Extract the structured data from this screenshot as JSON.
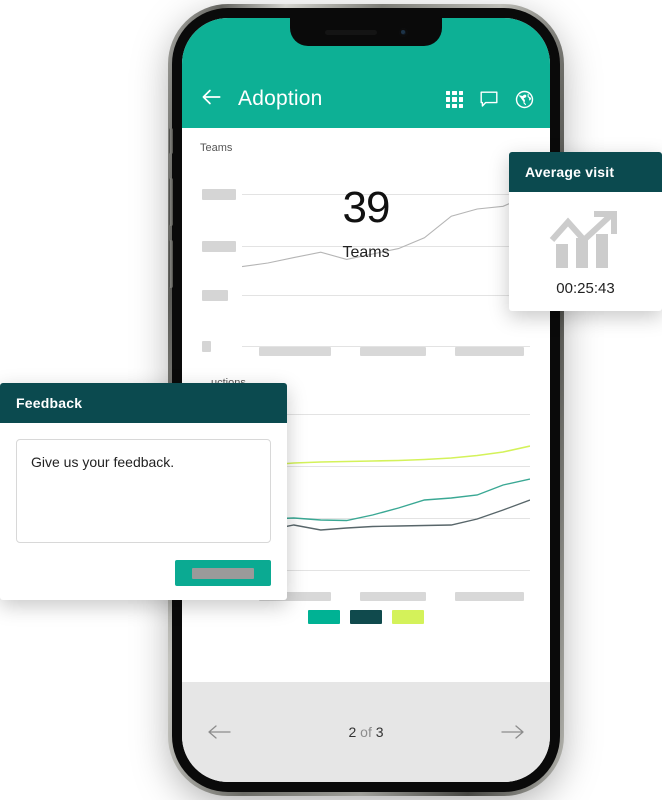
{
  "app": {
    "header": {
      "back_icon": "back-arrow-icon",
      "title": "Adoption",
      "icons": [
        {
          "name": "grid-icon",
          "label": "grid"
        },
        {
          "name": "comment-icon",
          "label": "comment"
        },
        {
          "name": "globe-icon",
          "label": "globe"
        }
      ]
    },
    "pager": {
      "prev_icon": "arrow-left-icon",
      "next_icon": "arrow-right-icon",
      "current": "2",
      "separator": " of ",
      "total": "3",
      "text": "2 of 3"
    }
  },
  "cards": {
    "average_visit": {
      "title": "Average visit",
      "icon": "bar-chart-trend-up-icon",
      "value": "00:25:43"
    },
    "feedback": {
      "title": "Feedback",
      "input_value": "Give us your feedback.",
      "input_placeholder": "Give us your feedback.",
      "submit_label": ""
    }
  },
  "colors": {
    "header_green": "#0DB095",
    "card_header_dark": "#0B4A4F",
    "accent_teal": "#00B294",
    "accent_dark_teal": "#104A4D",
    "accent_lime": "#D4F25A",
    "pager_bg": "#E6E6E6"
  },
  "chart_data": [
    {
      "type": "line",
      "title": "Teams",
      "metric_value": "39",
      "metric_label": "Teams",
      "xlabel": "",
      "ylabel": "Teams",
      "grid": true,
      "legend": "none",
      "ylim": [
        0,
        50
      ],
      "ytick_labels": [
        "",
        "",
        "",
        ""
      ],
      "xtick_labels": [
        "",
        "",
        ""
      ],
      "series": [
        {
          "name": "Teams",
          "color": "#b5b5b5",
          "x": [
            0,
            1,
            2,
            3,
            4,
            5,
            6,
            7,
            8,
            9,
            10,
            11
          ],
          "values": [
            18,
            19,
            20,
            21,
            20,
            21,
            22,
            24,
            28,
            31,
            32,
            36
          ]
        }
      ]
    },
    {
      "type": "line",
      "title": "…uctions",
      "xlabel": "",
      "ylabel": "",
      "grid": true,
      "legend": "bottom",
      "ylim": [
        0,
        50
      ],
      "ytick_labels": [
        "",
        "",
        "",
        ""
      ],
      "xtick_labels": [
        "",
        "",
        ""
      ],
      "series": [
        {
          "name": "series-lime",
          "color": "#D4F25A",
          "x": [
            0,
            1,
            2,
            3,
            4,
            5,
            6,
            7,
            8,
            9,
            10,
            11
          ],
          "values": [
            30,
            30.5,
            31,
            31.2,
            31.4,
            31.5,
            31.6,
            31.8,
            32,
            32.4,
            33,
            34.5
          ]
        },
        {
          "name": "series-teal",
          "color": "#3AA894",
          "x": [
            0,
            1,
            2,
            3,
            4,
            5,
            6,
            7,
            8,
            9,
            10,
            11
          ],
          "values": [
            15,
            15.4,
            15.6,
            15.2,
            15.1,
            16.2,
            17.6,
            19.2,
            19.6,
            20.2,
            22.2,
            23.4
          ]
        },
        {
          "name": "series-dark",
          "color": "#58666A",
          "x": [
            0,
            1,
            2,
            3,
            4,
            5,
            6,
            7,
            8,
            9,
            10,
            11
          ],
          "values": [
            12.4,
            13.2,
            14.2,
            13.2,
            13.6,
            13.9,
            14.0,
            14.1,
            14.2,
            15.4,
            17.2,
            19.2
          ]
        }
      ],
      "legend_items": [
        {
          "label": "",
          "color": "#00B294"
        },
        {
          "label": "",
          "color": "#104A4D"
        },
        {
          "label": "",
          "color": "#D4F25A"
        }
      ]
    }
  ]
}
